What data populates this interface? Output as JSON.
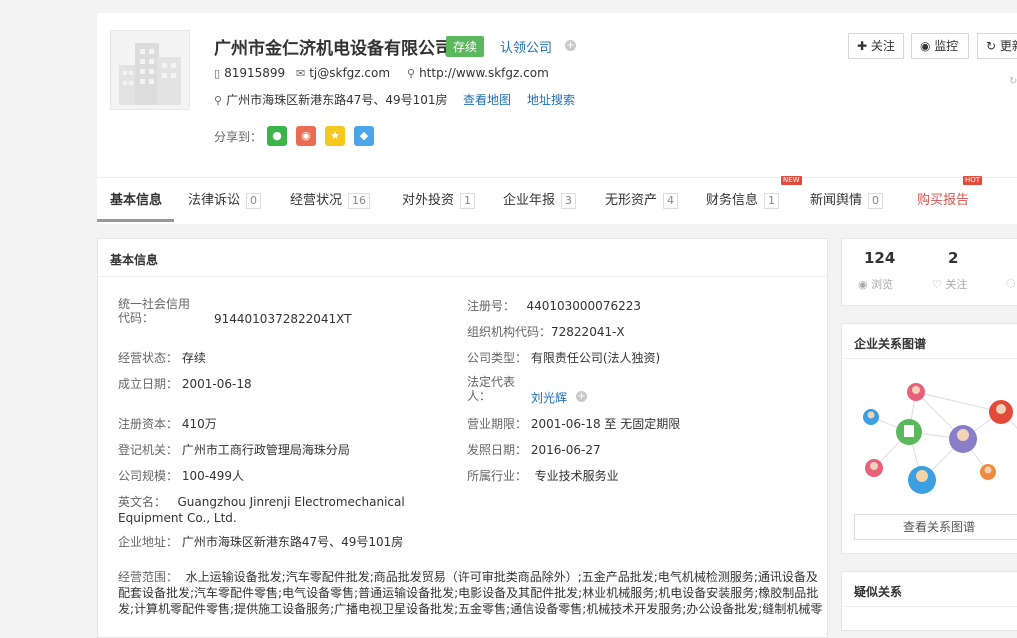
{
  "company": {
    "name": "广州市金仁济机电设备有限公司",
    "status": "存续",
    "claim": "认领公司",
    "phone": "81915899",
    "email": "tj@skfgz.com",
    "website": "http://www.skfgz.com",
    "address": "广州市海珠区新港东路47号、49号101房",
    "map_link": "查看地图",
    "address_search": "地址搜索",
    "share_label": "分享到："
  },
  "actions": {
    "follow": "关注",
    "monitor": "监控",
    "refresh": "更新"
  },
  "tabs": [
    {
      "label": "基本信息",
      "count": ""
    },
    {
      "label": "法律诉讼",
      "count": "0"
    },
    {
      "label": "经营状况",
      "count": "16"
    },
    {
      "label": "对外投资",
      "count": "1"
    },
    {
      "label": "企业年报",
      "count": "3"
    },
    {
      "label": "无形资产",
      "count": "4"
    },
    {
      "label": "财务信息",
      "count": "1"
    },
    {
      "label": "新闻舆情",
      "count": "0"
    },
    {
      "label": "购买报告",
      "count": ""
    }
  ],
  "badges": {
    "new": "NEW",
    "hot": "HOT"
  },
  "basic": {
    "title": "基本信息",
    "credit_code_label": "统一社会信用代码：",
    "credit_code": "9144010372822041XT",
    "reg_no_label": "注册号：",
    "reg_no": "440103000076223",
    "org_code_label": "组织机构代码：",
    "org_code": "72822041-X",
    "status_label": "经营状态：",
    "status": "存续",
    "type_label": "公司类型：",
    "type": "有限责任公司(法人独资)",
    "est_date_label": "成立日期：",
    "est_date": "2001-06-18",
    "legal_rep_label": "法定代表人：",
    "legal_rep": "刘光辉",
    "capital_label": "注册资本：",
    "capital": "410万",
    "term_label": "营业期限：",
    "term": "2001-06-18 至 无固定期限",
    "authority_label": "登记机关：",
    "authority": "广州市工商行政管理局海珠分局",
    "issue_date_label": "发照日期：",
    "issue_date": "2016-06-27",
    "scale_label": "公司规模：",
    "scale": "100-499人",
    "industry_label": "所属行业：",
    "industry": "专业技术服务业",
    "en_name_label": "英文名：",
    "en_name_1": "Guangzhou Jinrenji Electromechanical",
    "en_name_2": "Equipment Co., Ltd.",
    "address_label": "企业地址：",
    "address": "广州市海珠区新港东路47号、49号101房",
    "scope_label": "经营范围：",
    "scope_1": "水上运输设备批发;汽车零配件批发;商品批发贸易（许可审批类商品除外）;五金产品批发;电气机械检测服务;通讯设备及",
    "scope_2": "配套设备批发;汽车零配件零售;电气设备零售;普通运输设备批发;电影设备及其配件批发;林业机械服务;机电设备安装服务;橡胶制品批",
    "scope_3": "发;计算机零配件零售;提供施工设备服务;广播电视卫星设备批发;五金零售;通信设备零售;机械技术开发服务;办公设备批发;缝制机械零"
  },
  "stats": {
    "views": "124",
    "views_label": "浏览",
    "follows": "2",
    "follows_label": "关注"
  },
  "graph": {
    "title": "企业关系图谱",
    "button": "查看关系图谱"
  },
  "similar": {
    "title": "疑似关系"
  },
  "colors": {
    "accent": "#1f6fb5",
    "status_green": "#5cb85c",
    "buy_red": "#d9534f"
  }
}
